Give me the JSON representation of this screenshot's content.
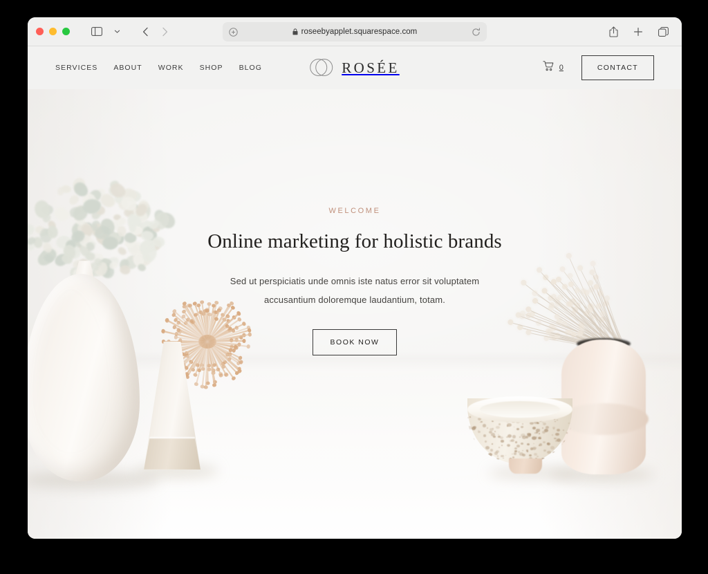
{
  "browser": {
    "traffic_lights": [
      "close",
      "minimize",
      "zoom"
    ],
    "sidebar_toggle_icon": "sidebar-icon",
    "sidebar_chevron_icon": "chevron-down-icon",
    "back_icon": "chevron-left-icon",
    "forward_icon": "chevron-right-icon",
    "address": {
      "url": "roseebyapplet.squarespace.com",
      "lock_icon": "lock-icon",
      "extension_icon": "extension-puzzle-icon",
      "reload_icon": "reload-icon"
    },
    "actions": {
      "share_icon": "share-icon",
      "new_tab_icon": "plus-icon",
      "tab_overview_icon": "tab-overview-icon"
    }
  },
  "site": {
    "nav": [
      {
        "label": "SERVICES"
      },
      {
        "label": "ABOUT"
      },
      {
        "label": "WORK"
      },
      {
        "label": "SHOP"
      },
      {
        "label": "BLOG"
      }
    ],
    "brand": {
      "name": "ROSÉE",
      "mark_icon": "overlapping-circles-logo-icon"
    },
    "cart": {
      "icon": "cart-icon",
      "count": "0"
    },
    "contact_button": "CONTACT"
  },
  "hero": {
    "eyebrow": "WELCOME",
    "title": "Online marketing for holistic brands",
    "subtitle": "Sed ut perspiciatis unde omnis iste natus error sit voluptatem accusantium doloremque laudantium, totam.",
    "cta": "BOOK NOW"
  },
  "colors": {
    "accent_rose": "#c0907c",
    "page_background": "#f2f2f1",
    "text_dark": "#22201e",
    "border_dark": "#3a3a3a",
    "desktop_background": "#000000"
  }
}
